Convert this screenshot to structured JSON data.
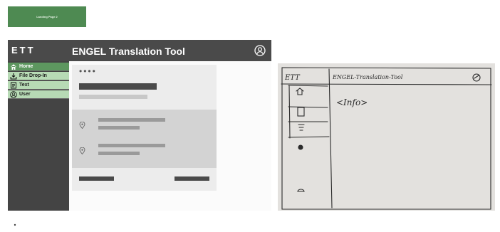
{
  "tag": {
    "label": "Landing Page 2"
  },
  "mockup": {
    "brand": "ETT",
    "title": "ENGEL Translation Tool",
    "nav": [
      {
        "label": "Home",
        "icon": "home-icon",
        "active": true
      },
      {
        "label": "File Drop-In",
        "icon": "download-icon",
        "active": false
      },
      {
        "label": "Text",
        "icon": "document-icon",
        "active": false
      },
      {
        "label": "User",
        "icon": "user-icon",
        "active": false
      }
    ],
    "card": {
      "dots": "••••"
    },
    "icons": {
      "user": "user-icon",
      "settings": "gear-icon",
      "pin": "location-pin-icon"
    },
    "colors": {
      "topbar": "#4a4a4a",
      "active_nav": "#5d975f",
      "nav": "#b7dab5",
      "tag": "#4e8a52"
    }
  },
  "sketch": {
    "brand": "ETT",
    "title": "ENGEL-Translation-Tool",
    "content": "<Info>"
  }
}
